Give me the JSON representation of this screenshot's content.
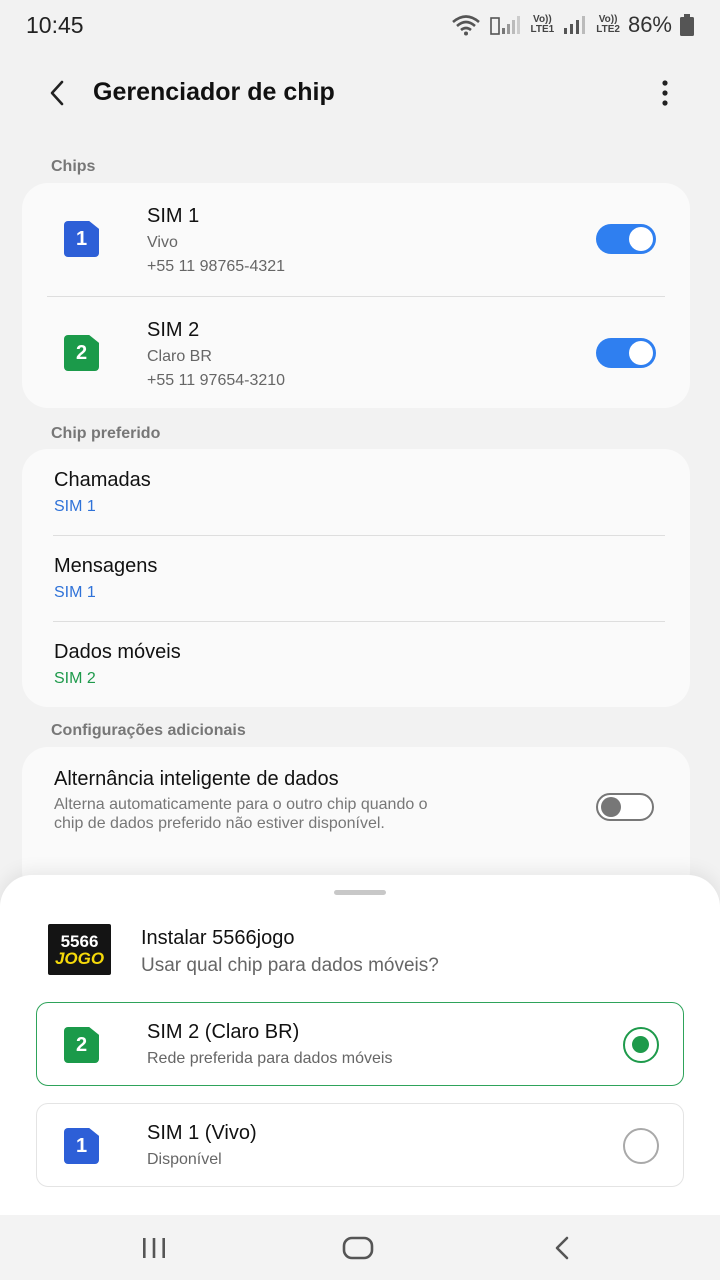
{
  "status_bar": {
    "time": "10:45",
    "sim1_net": "LTE1",
    "sim2_net": "LTE2",
    "volte": "Vo))",
    "battery": "86%"
  },
  "header": {
    "title": "Gerenciador de chip"
  },
  "chips": {
    "section_label": "Chips",
    "items": [
      {
        "badge": "1",
        "name": "SIM 1",
        "carrier": "Vivo",
        "number": "+55 11 98765-4321",
        "enabled": true,
        "color": "#2d5fd7"
      },
      {
        "badge": "2",
        "name": "SIM 2",
        "carrier": "Claro BR",
        "number": "+55 11 97654-3210",
        "enabled": true,
        "color": "#1b9a4a"
      }
    ]
  },
  "preferred": {
    "section_label": "Chip preferido",
    "items": [
      {
        "title": "Chamadas",
        "value": "SIM 1"
      },
      {
        "title": "Mensagens",
        "value": "SIM 1"
      },
      {
        "title": "Dados móveis",
        "value": "SIM 2"
      }
    ]
  },
  "additional": {
    "section_label": "Configurações adicionais",
    "smart_switch": {
      "title": "Alternância inteligente de dados",
      "description": "Alterna automaticamente para o outro chip quando o chip de dados preferido não estiver disponível.",
      "enabled": false
    }
  },
  "sheet": {
    "logo_top": "5566",
    "logo_bottom": "JOGO",
    "title": "Instalar 5566jogo",
    "subtitle": "Usar qual chip para dados móveis?",
    "options": [
      {
        "badge": "2",
        "title": "SIM 2 (Claro BR)",
        "subtitle": "Rede preferida para dados móveis",
        "selected": true
      },
      {
        "badge": "1",
        "title": "SIM 1 (Vivo)",
        "subtitle": "Disponível",
        "selected": false
      }
    ]
  },
  "colors": {
    "accent_blue": "#2f7ff0",
    "accent_green": "#1e9a4b"
  }
}
